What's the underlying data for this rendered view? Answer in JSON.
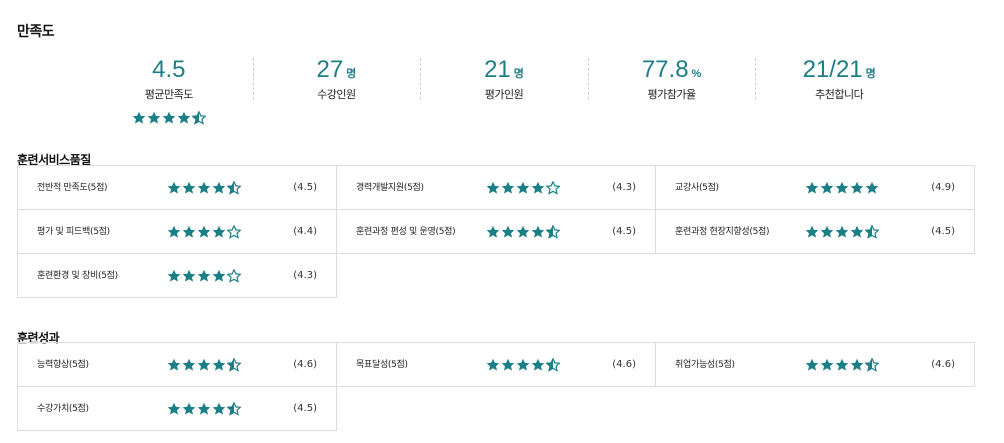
{
  "page": {
    "title": "만족도"
  },
  "summary": [
    {
      "value": "4.5",
      "unit": "",
      "label": "평균만족도",
      "stars": [
        1,
        1,
        1,
        1,
        0.5
      ]
    },
    {
      "value": "27",
      "unit": "명",
      "label": "수강인원"
    },
    {
      "value": "21",
      "unit": "명",
      "label": "평가인원"
    },
    {
      "value": "77.8",
      "unit": "%",
      "label": "평가참가율"
    },
    {
      "value": "21/21",
      "unit": "명",
      "label": "추천합니다"
    }
  ],
  "sections": [
    {
      "title": "훈련서비스품질",
      "items": [
        {
          "label": "전반적 만족도(5점)",
          "score": "(4.5)",
          "stars": [
            1,
            1,
            1,
            1,
            0.5
          ]
        },
        {
          "label": "경력개발지원(5점)",
          "score": "(4.3)",
          "stars": [
            1,
            1,
            1,
            1,
            0
          ]
        },
        {
          "label": "교강사(5점)",
          "score": "(4.9)",
          "stars": [
            1,
            1,
            1,
            1,
            1
          ]
        },
        {
          "label": "평가 및 피드백(5점)",
          "score": "(4.4)",
          "stars": [
            1,
            1,
            1,
            1,
            0
          ]
        },
        {
          "label": "훈련과정 편성 및 운영(5점)",
          "score": "(4.5)",
          "stars": [
            1,
            1,
            1,
            1,
            0.5
          ]
        },
        {
          "label": "훈련과정 현장지향성(5점)",
          "score": "(4.5)",
          "stars": [
            1,
            1,
            1,
            1,
            0.5
          ]
        },
        {
          "label": "훈련환경 및 장비(5점)",
          "score": "(4.3)",
          "stars": [
            1,
            1,
            1,
            1,
            0
          ]
        }
      ]
    },
    {
      "title": "훈련성과",
      "items": [
        {
          "label": "능력향상(5점)",
          "score": "(4.6)",
          "stars": [
            1,
            1,
            1,
            1,
            0.5
          ]
        },
        {
          "label": "목표달성(5점)",
          "score": "(4.6)",
          "stars": [
            1,
            1,
            1,
            1,
            0.5
          ]
        },
        {
          "label": "취업가능성(5점)",
          "score": "(4.6)",
          "stars": [
            1,
            1,
            1,
            1,
            0.5
          ]
        },
        {
          "label": "수강가치(5점)",
          "score": "(4.5)",
          "stars": [
            1,
            1,
            1,
            1,
            0.5
          ]
        }
      ]
    }
  ],
  "colors": {
    "accent": "#1d7f86",
    "border": "#dcdcdc"
  },
  "icons": {
    "star": "star-icon",
    "half_star": "half-star-icon",
    "empty_star": "empty-star-icon"
  }
}
